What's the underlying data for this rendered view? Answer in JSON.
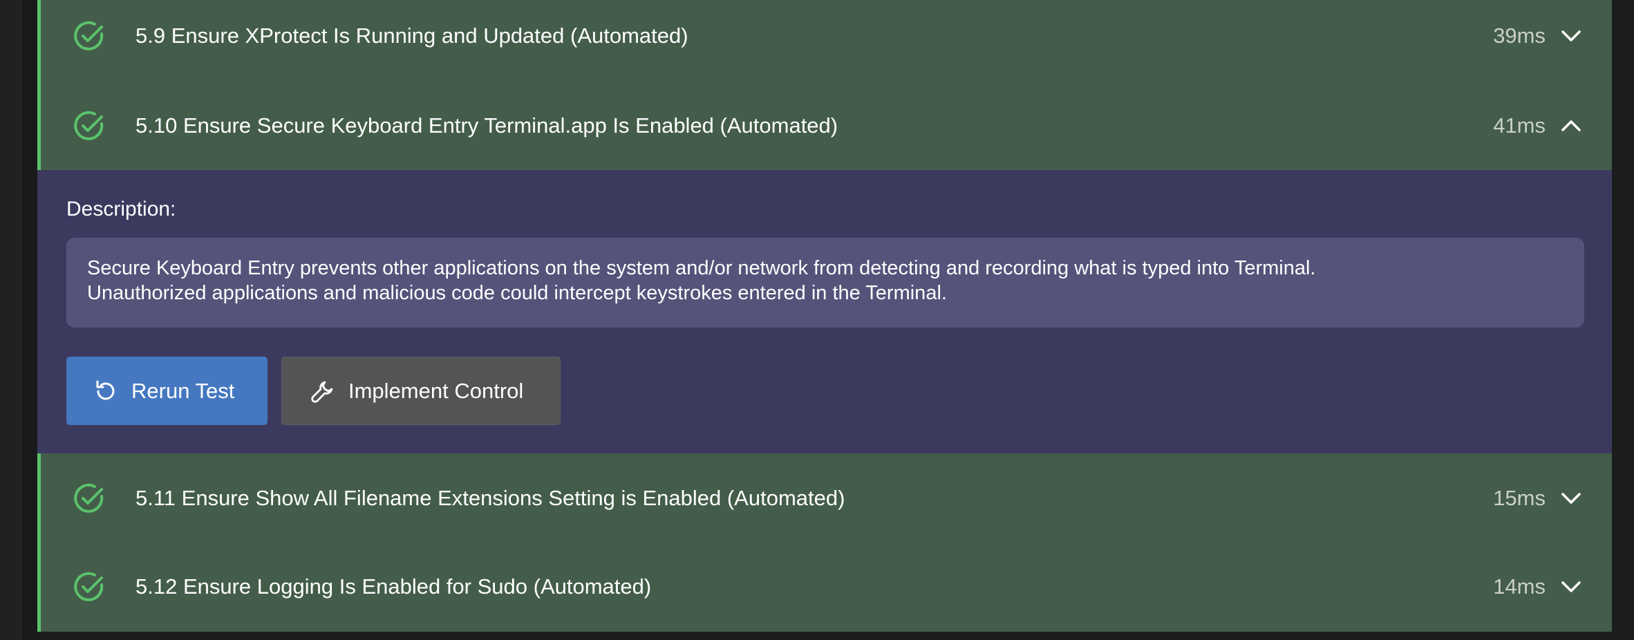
{
  "tests": [
    {
      "label": "5.9 Ensure XProtect Is Running and Updated (Automated)",
      "duration": "39ms",
      "expanded": false
    },
    {
      "label": "5.10 Ensure Secure Keyboard Entry Terminal.app Is Enabled (Automated)",
      "duration": "41ms",
      "expanded": true
    },
    {
      "label": "5.11 Ensure Show All Filename Extensions Setting is Enabled (Automated)",
      "duration": "15ms",
      "expanded": false
    },
    {
      "label": "5.12 Ensure Logging Is Enabled for Sudo (Automated)",
      "duration": "14ms",
      "expanded": false
    }
  ],
  "details": {
    "description_label": "Description:",
    "description_lines": [
      "Secure Keyboard Entry prevents other applications on the system and/or network from detecting and recording what is typed into Terminal.",
      "Unauthorized applications and malicious code could intercept keystrokes entered in the Terminal."
    ],
    "rerun_label": "Rerun Test",
    "implement_label": "Implement Control"
  },
  "icons": {
    "status": "check-circle-icon",
    "collapsed": "chevron-down-icon",
    "expanded": "chevron-up-icon",
    "rerun": "rotate-ccw-icon",
    "implement": "wrench-icon"
  },
  "colors": {
    "pass_accent": "#5bc26c",
    "row_background": "#445d4a",
    "details_background": "#3b3a5e",
    "primary_button": "#4578c1"
  }
}
